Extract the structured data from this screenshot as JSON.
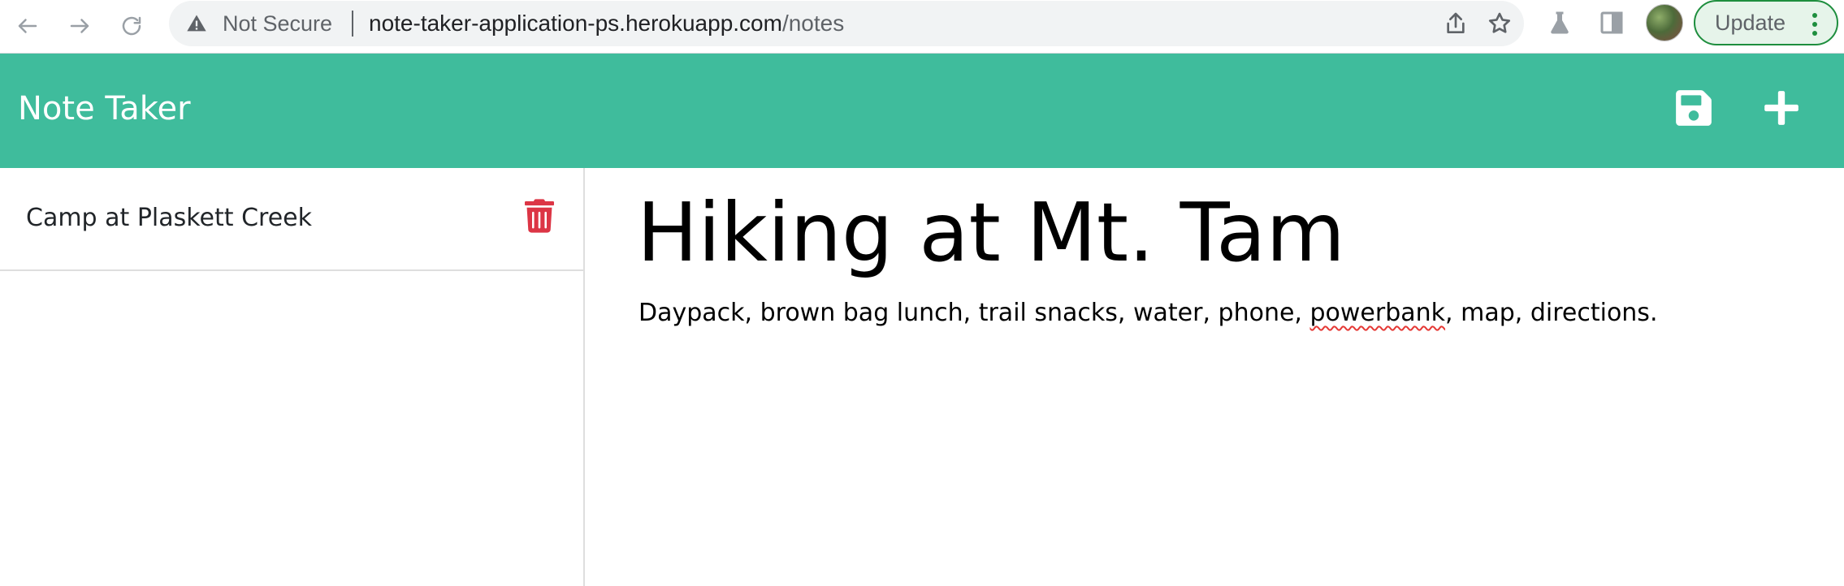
{
  "browser": {
    "security_label": "Not Secure",
    "url_host": "note-taker-application-ps.herokuapp.com",
    "url_path": "/notes",
    "update_label": "Update",
    "icons": {
      "back": "arrow-left-icon",
      "forward": "arrow-right-icon",
      "reload": "reload-icon",
      "warning": "warning-triangle-icon",
      "share": "share-icon",
      "bookmark": "star-icon",
      "labs": "flask-icon",
      "sidepanel": "side-panel-icon",
      "menu": "kebab-menu-icon"
    },
    "accent_color": "#1e8e3e"
  },
  "app": {
    "title": "Note Taker",
    "header_color": "#3fbc9c",
    "actions": {
      "save_icon": "save-icon",
      "new_icon": "plus-icon"
    }
  },
  "sidebar": {
    "items": [
      {
        "title": "Camp at Plaskett Creek",
        "delete_icon": "trash-icon",
        "delete_color": "#dc3545"
      }
    ]
  },
  "note": {
    "title": "Hiking at Mt. Tam",
    "text_before": "Daypack, brown bag lunch, trail snacks, water, phone, ",
    "text_misspelled": "powerbank",
    "text_after": ", map, directions."
  }
}
